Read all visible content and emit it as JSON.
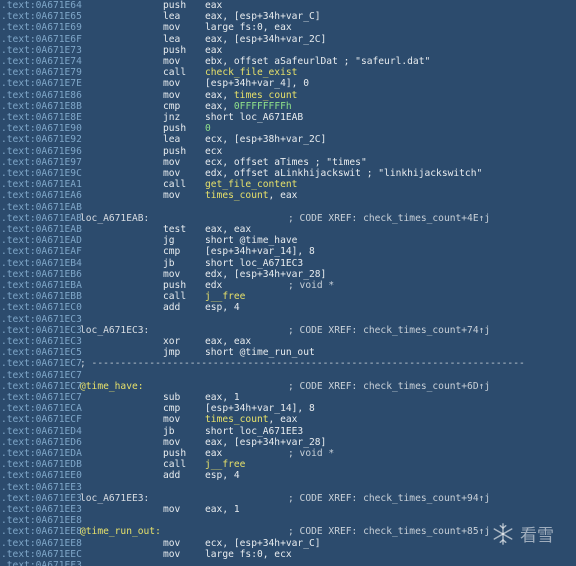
{
  "colors": {
    "background": "#2c4b6d",
    "address": "#7fa7c9",
    "text": "#e8ecef",
    "highlight_name": "#e6e06a",
    "number": "#8fe08a"
  },
  "lines": [
    {
      "addr": ".text:0A671E64",
      "label": "",
      "mnem": "push",
      "ops": [
        {
          "t": "eax"
        }
      ],
      "cmt": ""
    },
    {
      "addr": ".text:0A671E65",
      "label": "",
      "mnem": "lea",
      "ops": [
        {
          "t": "eax, [esp+34h+var_C]"
        }
      ],
      "cmt": ""
    },
    {
      "addr": ".text:0A671E69",
      "label": "",
      "mnem": "mov",
      "ops": [
        {
          "t": "large fs:0, eax"
        }
      ],
      "cmt": ""
    },
    {
      "addr": ".text:0A671E6F",
      "label": "",
      "mnem": "lea",
      "ops": [
        {
          "t": "eax, [esp+34h+var_2C]"
        }
      ],
      "cmt": ""
    },
    {
      "addr": ".text:0A671E73",
      "label": "",
      "mnem": "push",
      "ops": [
        {
          "t": "eax"
        }
      ],
      "cmt": ""
    },
    {
      "addr": ".text:0A671E74",
      "label": "",
      "mnem": "mov",
      "ops": [
        {
          "t": "ebx, offset aSafeurlDat ; \"safeurl.dat\""
        }
      ],
      "cmt": ""
    },
    {
      "addr": ".text:0A671E79",
      "label": "",
      "mnem": "call",
      "ops": [
        {
          "t": "check_file_exist",
          "c": "hl"
        }
      ],
      "cmt": ""
    },
    {
      "addr": ".text:0A671E7E",
      "label": "",
      "mnem": "mov",
      "ops": [
        {
          "t": "[esp+34h+var_4], 0"
        }
      ],
      "cmt": ""
    },
    {
      "addr": ".text:0A671E86",
      "label": "",
      "mnem": "mov",
      "ops": [
        {
          "t": "eax, "
        },
        {
          "t": "times_count",
          "c": "hl"
        }
      ],
      "cmt": ""
    },
    {
      "addr": ".text:0A671E8B",
      "label": "",
      "mnem": "cmp",
      "ops": [
        {
          "t": "eax, "
        },
        {
          "t": "0FFFFFFFFh",
          "c": "num"
        }
      ],
      "cmt": ""
    },
    {
      "addr": ".text:0A671E8E",
      "label": "",
      "mnem": "jnz",
      "ops": [
        {
          "t": "short loc_A671EAB"
        }
      ],
      "cmt": ""
    },
    {
      "addr": ".text:0A671E90",
      "label": "",
      "mnem": "push",
      "ops": [
        {
          "t": "0",
          "c": "num"
        }
      ],
      "cmt": ""
    },
    {
      "addr": ".text:0A671E92",
      "label": "",
      "mnem": "lea",
      "ops": [
        {
          "t": "ecx, [esp+38h+var_2C]"
        }
      ],
      "cmt": ""
    },
    {
      "addr": ".text:0A671E96",
      "label": "",
      "mnem": "push",
      "ops": [
        {
          "t": "ecx"
        }
      ],
      "cmt": ""
    },
    {
      "addr": ".text:0A671E97",
      "label": "",
      "mnem": "mov",
      "ops": [
        {
          "t": "ecx, offset aTimes ; \"times\""
        }
      ],
      "cmt": ""
    },
    {
      "addr": ".text:0A671E9C",
      "label": "",
      "mnem": "mov",
      "ops": [
        {
          "t": "edx, offset aLinkhijackswit ; \"linkhijackswitch\""
        }
      ],
      "cmt": ""
    },
    {
      "addr": ".text:0A671EA1",
      "label": "",
      "mnem": "call",
      "ops": [
        {
          "t": "get_file_content",
          "c": "hl"
        }
      ],
      "cmt": ""
    },
    {
      "addr": ".text:0A671EA6",
      "label": "",
      "mnem": "mov",
      "ops": [
        {
          "t": "times_count",
          "c": "hl"
        },
        {
          "t": ", eax"
        }
      ],
      "cmt": ""
    },
    {
      "addr": ".text:0A671EAB",
      "label": "",
      "mnem": "",
      "ops": [],
      "cmt": ""
    },
    {
      "addr": ".text:0A671EAB",
      "label": "loc_A671EAB:",
      "mnem": "",
      "ops": [],
      "cmt": "; CODE XREF: check_times_count+4E↑j"
    },
    {
      "addr": ".text:0A671EAB",
      "label": "",
      "mnem": "test",
      "ops": [
        {
          "t": "eax, eax"
        }
      ],
      "cmt": ""
    },
    {
      "addr": ".text:0A671EAD",
      "label": "",
      "mnem": "jg",
      "ops": [
        {
          "t": "short @time_have"
        }
      ],
      "cmt": ""
    },
    {
      "addr": ".text:0A671EAF",
      "label": "",
      "mnem": "cmp",
      "ops": [
        {
          "t": "[esp+34h+var_14], 8"
        }
      ],
      "cmt": ""
    },
    {
      "addr": ".text:0A671EB4",
      "label": "",
      "mnem": "jb",
      "ops": [
        {
          "t": "short loc_A671EC3"
        }
      ],
      "cmt": ""
    },
    {
      "addr": ".text:0A671EB6",
      "label": "",
      "mnem": "mov",
      "ops": [
        {
          "t": "edx, [esp+34h+var_28]"
        }
      ],
      "cmt": ""
    },
    {
      "addr": ".text:0A671EBA",
      "label": "",
      "mnem": "push",
      "ops": [
        {
          "t": "edx"
        }
      ],
      "cmt": "; void *"
    },
    {
      "addr": ".text:0A671EBB",
      "label": "",
      "mnem": "call",
      "ops": [
        {
          "t": "j__free",
          "c": "hl"
        }
      ],
      "cmt": ""
    },
    {
      "addr": ".text:0A671EC0",
      "label": "",
      "mnem": "add",
      "ops": [
        {
          "t": "esp, 4"
        }
      ],
      "cmt": ""
    },
    {
      "addr": ".text:0A671EC3",
      "label": "",
      "mnem": "",
      "ops": [],
      "cmt": ""
    },
    {
      "addr": ".text:0A671EC3",
      "label": "loc_A671EC3:",
      "mnem": "",
      "ops": [],
      "cmt": "; CODE XREF: check_times_count+74↑j"
    },
    {
      "addr": ".text:0A671EC3",
      "label": "",
      "mnem": "xor",
      "ops": [
        {
          "t": "eax, eax"
        }
      ],
      "cmt": ""
    },
    {
      "addr": ".text:0A671EC5",
      "label": "",
      "mnem": "jmp",
      "ops": [
        {
          "t": "short @time_run_out"
        }
      ],
      "cmt": ""
    },
    {
      "addr": ".text:0A671EC7",
      "label": "",
      "mnem": "",
      "ops": [],
      "cmt": "",
      "separator": "; ---------------------------------------------------------------------------"
    },
    {
      "addr": ".text:0A671EC7",
      "label": "",
      "mnem": "",
      "ops": [],
      "cmt": ""
    },
    {
      "addr": ".text:0A671EC7",
      "label": "@time_have:",
      "named": true,
      "mnem": "",
      "ops": [],
      "cmt": "; CODE XREF: check_times_count+6D↑j"
    },
    {
      "addr": ".text:0A671EC7",
      "label": "",
      "mnem": "sub",
      "ops": [
        {
          "t": "eax, 1"
        }
      ],
      "cmt": ""
    },
    {
      "addr": ".text:0A671ECA",
      "label": "",
      "mnem": "cmp",
      "ops": [
        {
          "t": "[esp+34h+var_14], 8"
        }
      ],
      "cmt": ""
    },
    {
      "addr": ".text:0A671ECF",
      "label": "",
      "mnem": "mov",
      "ops": [
        {
          "t": "times_count",
          "c": "hl"
        },
        {
          "t": ", eax"
        }
      ],
      "cmt": ""
    },
    {
      "addr": ".text:0A671ED4",
      "label": "",
      "mnem": "jb",
      "ops": [
        {
          "t": "short loc_A671EE3"
        }
      ],
      "cmt": ""
    },
    {
      "addr": ".text:0A671ED6",
      "label": "",
      "mnem": "mov",
      "ops": [
        {
          "t": "eax, [esp+34h+var_28]"
        }
      ],
      "cmt": ""
    },
    {
      "addr": ".text:0A671EDA",
      "label": "",
      "mnem": "push",
      "ops": [
        {
          "t": "eax"
        }
      ],
      "cmt": "; void *"
    },
    {
      "addr": ".text:0A671EDB",
      "label": "",
      "mnem": "call",
      "ops": [
        {
          "t": "j__free",
          "c": "hl"
        }
      ],
      "cmt": ""
    },
    {
      "addr": ".text:0A671EE0",
      "label": "",
      "mnem": "add",
      "ops": [
        {
          "t": "esp, 4"
        }
      ],
      "cmt": ""
    },
    {
      "addr": ".text:0A671EE3",
      "label": "",
      "mnem": "",
      "ops": [],
      "cmt": ""
    },
    {
      "addr": ".text:0A671EE3",
      "label": "loc_A671EE3:",
      "mnem": "",
      "ops": [],
      "cmt": "; CODE XREF: check_times_count+94↑j"
    },
    {
      "addr": ".text:0A671EE3",
      "label": "",
      "mnem": "mov",
      "ops": [
        {
          "t": "eax, 1"
        }
      ],
      "cmt": ""
    },
    {
      "addr": ".text:0A671EE8",
      "label": "",
      "mnem": "",
      "ops": [],
      "cmt": ""
    },
    {
      "addr": ".text:0A671EE8",
      "label": "@time_run_out:",
      "named": true,
      "mnem": "",
      "ops": [],
      "cmt": "; CODE XREF: check_times_count+85↑j"
    },
    {
      "addr": ".text:0A671EE8",
      "label": "",
      "mnem": "mov",
      "ops": [
        {
          "t": "ecx, [esp+34h+var_C]"
        }
      ],
      "cmt": ""
    },
    {
      "addr": ".text:0A671EEC",
      "label": "",
      "mnem": "mov",
      "ops": [
        {
          "t": "large fs:0, ecx"
        }
      ],
      "cmt": ""
    },
    {
      "addr": ".text:0A671EF3",
      "label": "",
      "mnem": "",
      "ops": [],
      "cmt": ""
    }
  ],
  "watermark": {
    "text": "看雪",
    "icon": "snowflake-icon"
  }
}
